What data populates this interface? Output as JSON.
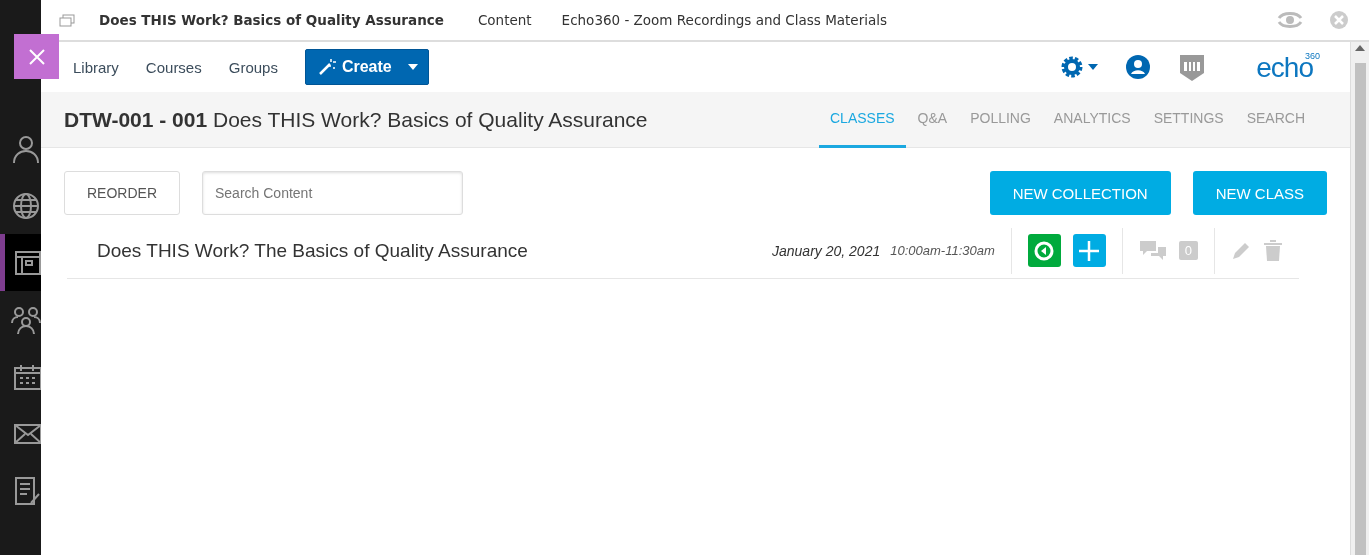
{
  "sidebar": {
    "items": [
      {
        "kind": "person",
        "selected": false
      },
      {
        "kind": "globe",
        "selected": false
      },
      {
        "kind": "courses",
        "selected": true
      },
      {
        "kind": "groups",
        "selected": false
      },
      {
        "kind": "calendar",
        "selected": false
      },
      {
        "kind": "mail",
        "selected": false
      },
      {
        "kind": "grades",
        "selected": false
      }
    ]
  },
  "frame_header": {
    "title": "Does THIS Work? Basics of Quality Assurance",
    "crumbs": [
      "Content",
      "Echo360 - Zoom Recordings and Class Materials"
    ]
  },
  "nav": {
    "links": [
      "Library",
      "Courses",
      "Groups"
    ],
    "create": "Create",
    "logo": {
      "name": "echo",
      "superscript": "360"
    }
  },
  "course": {
    "code": "DTW-001 - 001",
    "name": "Does THIS Work? Basics of Quality Assurance"
  },
  "tabs": [
    {
      "label": "CLASSES",
      "selected": true
    },
    {
      "label": "Q&A",
      "selected": false
    },
    {
      "label": "POLLING",
      "selected": false
    },
    {
      "label": "ANALYTICS",
      "selected": false
    },
    {
      "label": "SETTINGS",
      "selected": false
    },
    {
      "label": "SEARCH",
      "selected": false
    }
  ],
  "toolbar": {
    "reorder": "REORDER",
    "search": {
      "placeholder": "Search Content"
    },
    "buttons": [
      "NEW COLLECTION",
      "NEW CLASS"
    ]
  },
  "classes": [
    {
      "title": "Does THIS Work? The Basics of Quality Assurance",
      "date": "January 20, 2021",
      "time": "10:00am-11:30am",
      "comments": "0"
    }
  ]
}
